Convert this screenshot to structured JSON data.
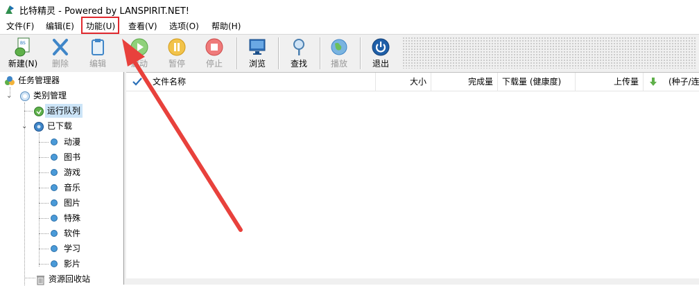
{
  "window": {
    "title": "比特精灵 - Powered by LANSPIRIT.NET!"
  },
  "menu": [
    "文件(F)",
    "编辑(E)",
    "功能(U)",
    "查看(V)",
    "选项(O)",
    "帮助(H)"
  ],
  "toolbar": {
    "new": "新建(N)",
    "delete": "删除",
    "edit": "编辑",
    "start": "启动",
    "pause": "暂停",
    "stop": "停止",
    "browse": "浏览",
    "find": "查找",
    "play": "播放",
    "exit": "退出"
  },
  "tree": {
    "root": "任务管理器",
    "category_mgmt": "类别管理",
    "running_queue": "运行队列",
    "downloaded": "已下载",
    "subcategories": [
      "动漫",
      "图书",
      "游戏",
      "音乐",
      "图片",
      "特殊",
      "软件",
      "学习",
      "影片"
    ],
    "recycle": "资源回收站"
  },
  "list": {
    "columns": [
      "文件名称",
      "大小",
      "完成量",
      "下载量 (健康度)",
      "上传量",
      "(种子/连"
    ]
  },
  "colors": {
    "highlight_box": "#e0282d",
    "arrow": "#e8413c",
    "selection": "#cce4f7"
  }
}
